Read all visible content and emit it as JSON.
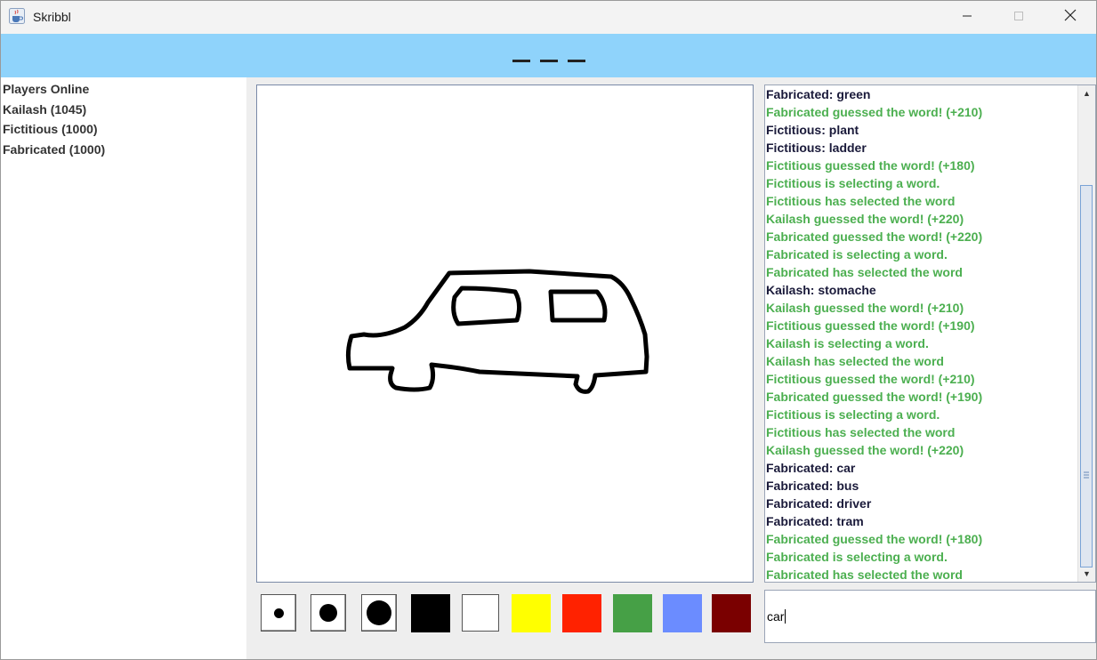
{
  "window": {
    "title": "Skribbl"
  },
  "word_hint": {
    "blanks": 3
  },
  "players": {
    "header": "Players Online",
    "list": [
      "Kailash (1045)",
      "Fictitious (1000)",
      "Fabricated (1000)"
    ]
  },
  "tools": {
    "brush_sizes": [
      "small",
      "medium",
      "large"
    ],
    "colors": [
      "#000000",
      "#ffffff",
      "#ffff00",
      "#ff2200",
      "#46a046",
      "#6b8cff",
      "#7a0000"
    ]
  },
  "chat": {
    "messages": [
      {
        "text": "Fabricated: green",
        "type": "guess"
      },
      {
        "text": "Fabricated guessed the word! (+210)",
        "type": "system"
      },
      {
        "text": "Fictitious: plant",
        "type": "guess"
      },
      {
        "text": "Fictitious: ladder",
        "type": "guess"
      },
      {
        "text": "Fictitious guessed the word! (+180)",
        "type": "system"
      },
      {
        "text": "Fictitious is selecting a word.",
        "type": "system"
      },
      {
        "text": "Fictitious has selected the word",
        "type": "system"
      },
      {
        "text": "Kailash guessed the word! (+220)",
        "type": "system"
      },
      {
        "text": "Fabricated guessed the word! (+220)",
        "type": "system"
      },
      {
        "text": "Fabricated is selecting a word.",
        "type": "system"
      },
      {
        "text": "Fabricated has selected the word",
        "type": "system"
      },
      {
        "text": "Kailash: stomache",
        "type": "guess"
      },
      {
        "text": "Kailash guessed the word! (+210)",
        "type": "system"
      },
      {
        "text": "Fictitious guessed the word! (+190)",
        "type": "system"
      },
      {
        "text": "Kailash is selecting a word.",
        "type": "system"
      },
      {
        "text": "Kailash has selected the word",
        "type": "system"
      },
      {
        "text": "Fictitious guessed the word! (+210)",
        "type": "system"
      },
      {
        "text": "Fabricated guessed the word! (+190)",
        "type": "system"
      },
      {
        "text": "Fictitious is selecting a word.",
        "type": "system"
      },
      {
        "text": "Fictitious has selected the word",
        "type": "system"
      },
      {
        "text": "Kailash guessed the word! (+220)",
        "type": "system"
      },
      {
        "text": "Fabricated: car",
        "type": "guess"
      },
      {
        "text": "Fabricated: bus",
        "type": "guess"
      },
      {
        "text": "Fabricated: driver",
        "type": "guess"
      },
      {
        "text": "Fabricated: tram",
        "type": "guess"
      },
      {
        "text": "Fabricated guessed the word! (+180)",
        "type": "system"
      },
      {
        "text": "Fabricated is selecting a word.",
        "type": "system"
      },
      {
        "text": "Fabricated has selected the word",
        "type": "system"
      }
    ],
    "input_value": "car",
    "colors": {
      "guess": "#1a1a3a",
      "system": "#4caf50"
    }
  },
  "colors": {
    "banner": "#8fd3fb"
  }
}
